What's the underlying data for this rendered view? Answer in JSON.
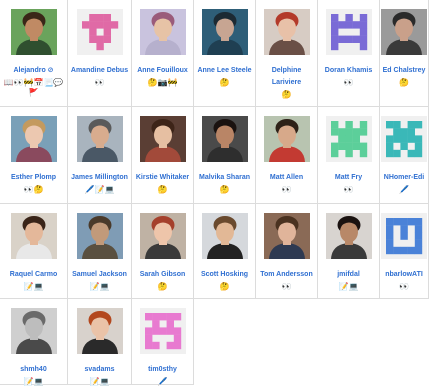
{
  "contributors": [
    {
      "name": "Alejandro ⊘",
      "reactions": "📖👀🚧📅📃💬🚩",
      "avatar": {
        "kind": "photo",
        "bg": "#6aa35c",
        "skin": "#c08a64",
        "hair": "#3a2618",
        "shirt": "#2f4f2f"
      }
    },
    {
      "name": "Amandine Debus",
      "reactions": "👀",
      "avatar": {
        "kind": "identicon",
        "color": "#e06aa6",
        "pattern": [
          [
            0,
            1,
            1,
            1,
            0
          ],
          [
            1,
            1,
            1,
            1,
            1
          ],
          [
            0,
            1,
            0,
            1,
            0
          ],
          [
            0,
            1,
            1,
            1,
            0
          ],
          [
            0,
            0,
            1,
            0,
            0
          ]
        ]
      }
    },
    {
      "name": "Anne Fouilloux",
      "reactions": "🤔📷🚧",
      "avatar": {
        "kind": "photo",
        "bg": "#c9c3de",
        "skin": "#e7c3a6",
        "hair": "#9a5b7a",
        "shirt": "#b6b0cd"
      }
    },
    {
      "name": "Anne Lee Steele",
      "reactions": "🤔",
      "avatar": {
        "kind": "photo",
        "bg": "#2e5e78",
        "skin": "#c7a592",
        "hair": "#1c2a33",
        "shirt": "#1f3f52"
      }
    },
    {
      "name": "Delphine Lariviere",
      "reactions": "🤔",
      "avatar": {
        "kind": "photo",
        "bg": "#d7ccc4",
        "skin": "#e8c1a8",
        "hair": "#b33a2a",
        "shirt": "#6a4f46"
      }
    },
    {
      "name": "Doran Khamis",
      "reactions": "👀",
      "avatar": {
        "kind": "identicon",
        "color": "#7a6bd6",
        "pattern": [
          [
            1,
            0,
            1,
            0,
            1
          ],
          [
            1,
            1,
            1,
            1,
            1
          ],
          [
            1,
            0,
            0,
            0,
            1
          ],
          [
            1,
            1,
            1,
            1,
            1
          ],
          [
            1,
            0,
            0,
            0,
            1
          ]
        ]
      }
    },
    {
      "name": "Ed Chalstrey",
      "reactions": "🤔",
      "avatar": {
        "kind": "photo",
        "bg": "#9a9a9a",
        "skin": "#c9a08a",
        "hair": "#2a2a2a",
        "shirt": "#3a3a3a"
      }
    },
    {
      "name": "Esther Plomp",
      "reactions": "👀🤔",
      "avatar": {
        "kind": "photo",
        "bg": "#7aa0b8",
        "skin": "#ecc8b0",
        "hair": "#c49a5e",
        "shirt": "#8a4a5e"
      }
    },
    {
      "name": "James Millington",
      "reactions": "🖊️📝💻",
      "avatar": {
        "kind": "photo",
        "bg": "#a9b4be",
        "skin": "#d8ac8e",
        "hair": "#5a5a5a",
        "shirt": "#4a5866"
      }
    },
    {
      "name": "Kirstie Whitaker",
      "reactions": "🤔",
      "avatar": {
        "kind": "photo",
        "bg": "#5a3e34",
        "skin": "#e6bfa2",
        "hair": "#3d2418",
        "shirt": "#a24a3a"
      }
    },
    {
      "name": "Malvika Sharan",
      "reactions": "🤔",
      "avatar": {
        "kind": "photo",
        "bg": "#4a4a4a",
        "skin": "#b98566",
        "hair": "#1a1210",
        "shirt": "#2e2e2e"
      }
    },
    {
      "name": "Matt Allen",
      "reactions": "👀",
      "avatar": {
        "kind": "photo",
        "bg": "#b8c4b0",
        "skin": "#d7a98a",
        "hair": "#2e2218",
        "shirt": "#c33a32"
      }
    },
    {
      "name": "Matt Fry",
      "reactions": "👀",
      "avatar": {
        "kind": "identicon",
        "color": "#5ccf9a",
        "pattern": [
          [
            1,
            0,
            1,
            0,
            1
          ],
          [
            1,
            1,
            1,
            1,
            1
          ],
          [
            0,
            1,
            1,
            1,
            0
          ],
          [
            1,
            1,
            1,
            1,
            1
          ],
          [
            1,
            0,
            1,
            0,
            1
          ]
        ]
      }
    },
    {
      "name": "NHomer-Edi",
      "reactions": "🖊️",
      "avatar": {
        "kind": "identicon",
        "color": "#3ab8b8",
        "pattern": [
          [
            1,
            1,
            0,
            1,
            1
          ],
          [
            0,
            1,
            1,
            1,
            0
          ],
          [
            1,
            1,
            1,
            1,
            1
          ],
          [
            1,
            0,
            1,
            0,
            1
          ],
          [
            1,
            1,
            0,
            1,
            1
          ]
        ]
      }
    },
    {
      "name": "Raquel Carmo",
      "reactions": "📝💻",
      "avatar": {
        "kind": "photo",
        "bg": "#d9d2c8",
        "skin": "#e4b89a",
        "hair": "#3a2418",
        "shirt": "#e8e8e8"
      }
    },
    {
      "name": "Samuel Jackson",
      "reactions": "📝💻",
      "avatar": {
        "kind": "photo",
        "bg": "#7f9cb5",
        "skin": "#c29a7a",
        "hair": "#4a3a2a",
        "shirt": "#5a5040"
      }
    },
    {
      "name": "Sarah Gibson",
      "reactions": "🤔",
      "avatar": {
        "kind": "photo",
        "bg": "#bfb2a4",
        "skin": "#eec5aa",
        "hair": "#a5402c",
        "shirt": "#3a3a3a"
      }
    },
    {
      "name": "Scott Hosking",
      "reactions": "🤔",
      "avatar": {
        "kind": "photo",
        "bg": "#d5d8dc",
        "skin": "#e2b896",
        "hair": "#6a4a2e",
        "shirt": "#222222"
      }
    },
    {
      "name": "Tom Andersson",
      "reactions": "👀",
      "avatar": {
        "kind": "photo",
        "bg": "#8a6a56",
        "skin": "#e0b49a",
        "hair": "#4a3220",
        "shirt": "#2e3a52"
      }
    },
    {
      "name": "jmifdal",
      "reactions": "📝💻",
      "avatar": {
        "kind": "photo",
        "bg": "#d8d4d0",
        "skin": "#b88868",
        "hair": "#1a1210",
        "shirt": "#3a3a3a"
      }
    },
    {
      "name": "nbarlowATI",
      "reactions": "👀",
      "avatar": {
        "kind": "identicon",
        "color": "#4a82d8",
        "pattern": [
          [
            1,
            1,
            1,
            1,
            1
          ],
          [
            1,
            0,
            1,
            0,
            1
          ],
          [
            1,
            0,
            1,
            0,
            1
          ],
          [
            1,
            0,
            0,
            0,
            1
          ],
          [
            1,
            1,
            1,
            1,
            1
          ]
        ]
      }
    },
    {
      "name": "shmh40",
      "reactions": "📝💻",
      "avatar": {
        "kind": "photo",
        "bg": "#cfcfcf",
        "skin": "#bdbdbd",
        "hair": "#6a6a6a",
        "shirt": "#4a4a4a"
      }
    },
    {
      "name": "svadams",
      "reactions": "📝💻",
      "avatar": {
        "kind": "photo",
        "bg": "#d8d2cc",
        "skin": "#eac3a8",
        "hair": "#b3481e",
        "shirt": "#2a2a2a"
      }
    },
    {
      "name": "tim0sthy",
      "reactions": "🖊️",
      "avatar": {
        "kind": "identicon",
        "color": "#e87ad0",
        "pattern": [
          [
            1,
            1,
            1,
            1,
            1
          ],
          [
            0,
            1,
            0,
            1,
            0
          ],
          [
            1,
            1,
            1,
            1,
            1
          ],
          [
            1,
            0,
            0,
            0,
            1
          ],
          [
            1,
            1,
            0,
            1,
            1
          ]
        ]
      }
    }
  ]
}
